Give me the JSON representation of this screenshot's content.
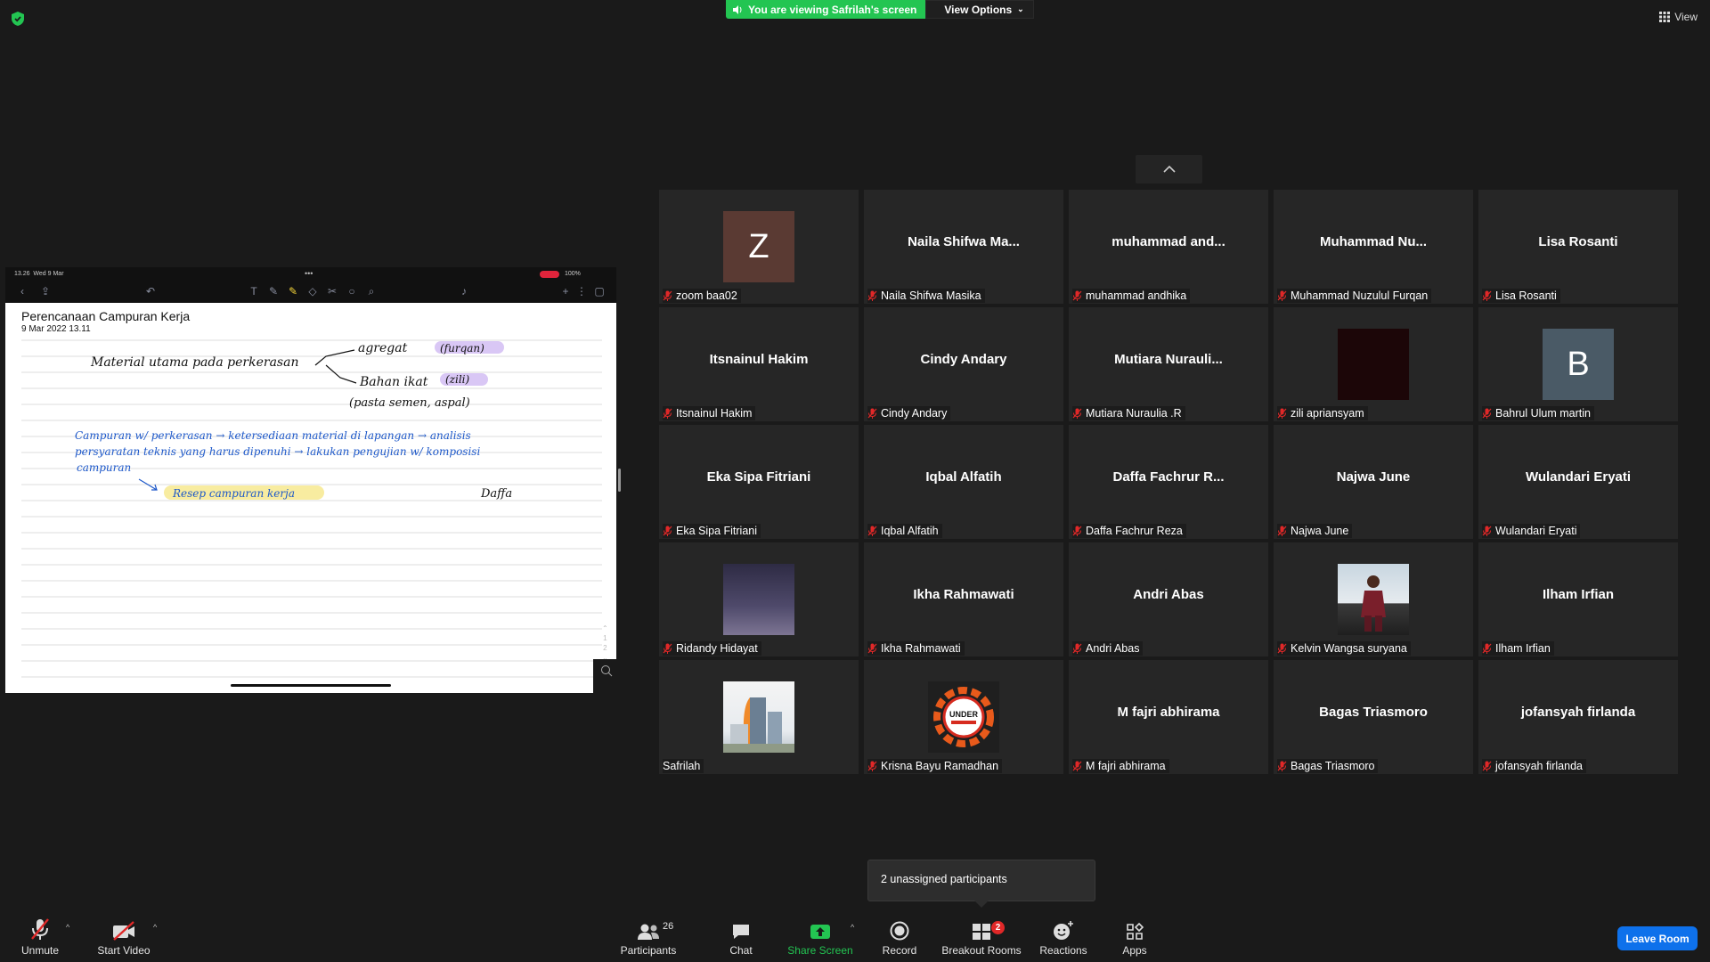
{
  "banner": {
    "viewing_text": "You are viewing Safrilah's screen",
    "view_options": "View Options"
  },
  "view_button": "View",
  "shared_screen": {
    "status_time": "13.26",
    "status_date": "Wed 9 Mar",
    "status_battery": "100%",
    "note_title": "Perencanaan Campuran Kerja",
    "note_date": "9 Mar 2022 13.11",
    "handwriting": {
      "main_topic": "Material utama pada perkerasan",
      "branch_1": "agregat",
      "branch_1_name": "(furqan)",
      "branch_2": "Bahan ikat",
      "branch_2_name": "(zili)",
      "branch_2_detail": "(pasta semen, aspal)",
      "flow_line_1": "Campuran w/ perkerasan → ketersediaan material di lapangan → analisis",
      "flow_line_2": "persyaratan teknis yang harus dipenuhi → lakukan pengujian w/ komposisi",
      "flow_line_3": "campuran",
      "result": "Resep campuran kerja",
      "signature_name": "Daffa"
    },
    "page_indicator": [
      "1",
      "2"
    ]
  },
  "participants": [
    {
      "big_name": "",
      "avatar_letter": "Z",
      "avatar_color": "#5a3a33",
      "label": "zoom baa02",
      "muted": true
    },
    {
      "big_name": "Naila Shifwa Ma...",
      "label": "Naila Shifwa Masika",
      "muted": true
    },
    {
      "big_name": "muhammad and...",
      "label": "muhammad andhika",
      "muted": true
    },
    {
      "big_name": "Muhammad Nu...",
      "label": "Muhammad Nuzulul Furqan",
      "muted": true
    },
    {
      "big_name": "Lisa Rosanti",
      "label": "Lisa Rosanti",
      "muted": true
    },
    {
      "big_name": "Itsnainul Hakim",
      "label": "Itsnainul Hakim",
      "muted": true
    },
    {
      "big_name": "Cindy Andary",
      "label": "Cindy Andary",
      "muted": true
    },
    {
      "big_name": "Mutiara Nurauli...",
      "label": "Mutiara Nuraulia .R",
      "muted": true
    },
    {
      "big_name": "",
      "avatar": "dark-photo",
      "label": "zili apriansyam",
      "muted": true
    },
    {
      "big_name": "",
      "avatar_letter": "B",
      "avatar_color": "#4a5a66",
      "label": "Bahrul Ulum martin",
      "muted": true
    },
    {
      "big_name": "Eka Sipa Fitriani",
      "label": "Eka Sipa Fitriani",
      "muted": true
    },
    {
      "big_name": "Iqbal Alfatih",
      "label": "Iqbal Alfatih",
      "muted": true
    },
    {
      "big_name": "Daffa Fachrur R...",
      "label": "Daffa Fachrur Reza",
      "muted": true
    },
    {
      "big_name": "Najwa June",
      "label": "Najwa June",
      "muted": true
    },
    {
      "big_name": "Wulandari Eryati",
      "label": "Wulandari Eryati",
      "muted": true
    },
    {
      "big_name": "",
      "avatar": "gradient-photo",
      "label": "Ridandy Hidayat",
      "muted": true
    },
    {
      "big_name": "Ikha Rahmawati",
      "label": "Ikha Rahmawati",
      "muted": true
    },
    {
      "big_name": "Andri Abas",
      "label": "Andri Abas",
      "muted": true
    },
    {
      "big_name": "",
      "avatar": "person-photo",
      "label": "Kelvin Wangsa suryana",
      "muted": true
    },
    {
      "big_name": "Ilham Irfian",
      "label": "Ilham Irfian",
      "muted": true
    },
    {
      "big_name": "",
      "avatar": "building-photo",
      "label": "Safrilah",
      "muted": false
    },
    {
      "big_name": "",
      "avatar": "under-construction-logo",
      "avatar_text": "UNDER",
      "label": "Krisna Bayu Ramadhan",
      "muted": true
    },
    {
      "big_name": "M fajri abhirama",
      "label": "M fajri abhirama",
      "muted": true
    },
    {
      "big_name": "Bagas Triasmoro",
      "label": "Bagas Triasmoro",
      "muted": true
    },
    {
      "big_name": "jofansyah firlanda",
      "label": "jofansyah firlanda",
      "muted": true
    }
  ],
  "popup": {
    "unassigned_text": "2 unassigned participants"
  },
  "toolbar": {
    "unmute": "Unmute",
    "start_video": "Start Video",
    "participants": "Participants",
    "participant_count": "26",
    "chat": "Chat",
    "share_screen": "Share Screen",
    "record": "Record",
    "breakout_rooms": "Breakout Rooms",
    "breakout_badge": "2",
    "reactions": "Reactions",
    "apps": "Apps",
    "leave_room": "Leave Room"
  },
  "colors": {
    "accent_green": "#23c552",
    "leave_blue": "#0e71eb",
    "muted_red": "#e02828",
    "tile_bg": "#262626"
  }
}
